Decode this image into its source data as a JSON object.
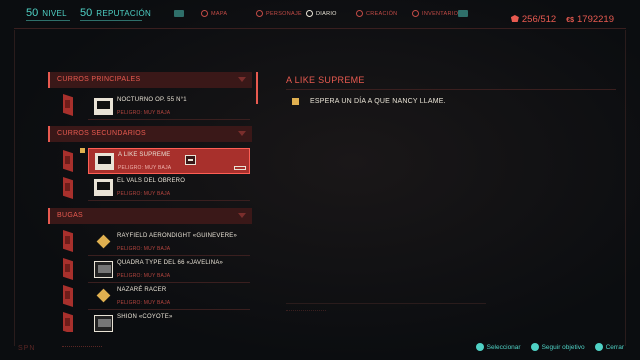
{
  "topbar": {
    "level": {
      "value": "50",
      "label": "NIVEL"
    },
    "reputation": {
      "value": "50",
      "label": "REPUTACIÓN"
    },
    "tabs": [
      {
        "label": "MAPA",
        "icon": "map-icon"
      },
      {
        "label": "PERSONAJE",
        "icon": "character-icon"
      },
      {
        "label": "DIARIO",
        "icon": "journal-icon"
      },
      {
        "label": "CREACIÓN",
        "icon": "crafting-icon"
      },
      {
        "label": "INVENTARIO",
        "icon": "inventory-icon"
      }
    ],
    "weight": "256/512",
    "money": "1792219",
    "money_symbol": "€$"
  },
  "categories": [
    {
      "label": "CURROS PRINCIPALES"
    },
    {
      "label": "CURROS SECUNDARIOS"
    },
    {
      "label": "BUGAS"
    }
  ],
  "entries": [
    {
      "name": "NOCTURNO OP. 55 N°1",
      "danger": "PELIGRO: MUY BAJA"
    },
    {
      "name": "A LIKE SUPREME",
      "danger": "PELIGRO: MUY BAJA"
    },
    {
      "name": "EL VALS DEL OBRERO",
      "danger": "PELIGRO: MUY BAJA"
    },
    {
      "name": "RAYFIELD AERONDIGHT «GUINEVERE»",
      "danger": "PELIGRO: MUY BAJA"
    },
    {
      "name": "QUADRA TYPE DEL 66 «JAVELINA»",
      "danger": "PELIGRO: MUY BAJA"
    },
    {
      "name": "NAZARÉ RACER",
      "danger": "PELIGRO: MUY BAJA"
    },
    {
      "name": "SHION «COYOTE»",
      "danger": ""
    }
  ],
  "detail": {
    "title": "A LIKE SUPREME",
    "objective": "ESPERA UN DÍA A QUE NANCY LLAME."
  },
  "hints": [
    {
      "label": "Seleccionar"
    },
    {
      "label": "Seguir objetivo"
    },
    {
      "label": "Cerrar"
    }
  ],
  "colors": {
    "accent": "#e85a50",
    "cyan": "#4fd1c5",
    "selected": "#a8302c",
    "text": "#e9e3d6"
  }
}
